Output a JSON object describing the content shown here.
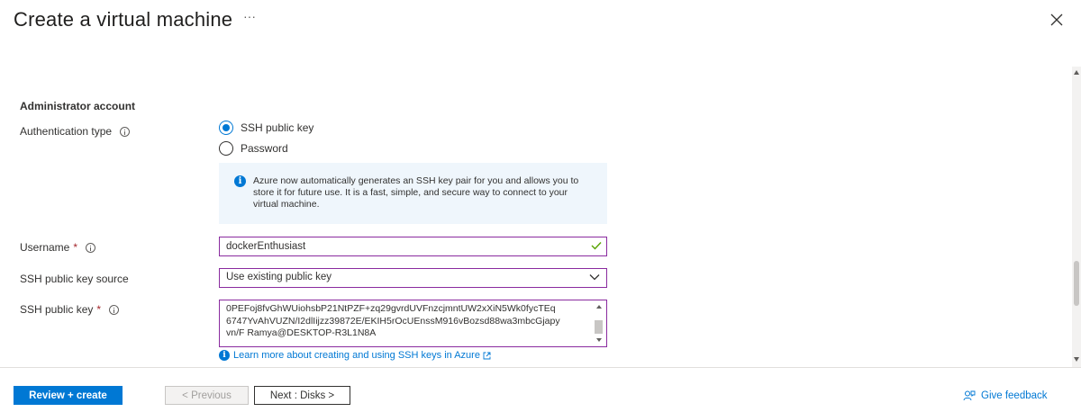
{
  "header": {
    "title": "Create a virtual machine",
    "more_label": "···"
  },
  "section": {
    "heading": "Administrator account"
  },
  "auth": {
    "label": "Authentication type",
    "options": [
      {
        "label": "SSH public key",
        "selected": true
      },
      {
        "label": "Password",
        "selected": false
      }
    ],
    "info_text": "Azure now automatically generates an SSH key pair for you and allows you to store it for future use. It is a fast, simple, and secure way to connect to your virtual machine."
  },
  "username": {
    "label": "Username",
    "required_mark": "*",
    "value": "dockerEnthusiast"
  },
  "key_source": {
    "label": "SSH public key source",
    "value": "Use existing public key"
  },
  "public_key": {
    "label": "SSH public key",
    "required_mark": "*",
    "value": "0PEFoj8fvGhWUiohsbP21NtPZF+zq29gvrdUVFnzcjmntUW2xXiN5Wk0fycTEq\n6747YvAhVUZN/I2dlIijzz39872E/EKIH5rOcUEnssM916vBozsd88wa3mbcGjapy\nvn/F Ramya@DESKTOP-R3L1N8A",
    "learn_link": "Learn more about creating and using SSH keys in Azure"
  },
  "footer": {
    "review_label": "Review + create",
    "previous_label": "< Previous",
    "next_label": "Next : Disks >",
    "feedback_label": "Give feedback"
  },
  "colors": {
    "accent": "#0078d4",
    "field_border": "#8a2b9f",
    "success": "#57a300",
    "required": "#a4262c"
  }
}
